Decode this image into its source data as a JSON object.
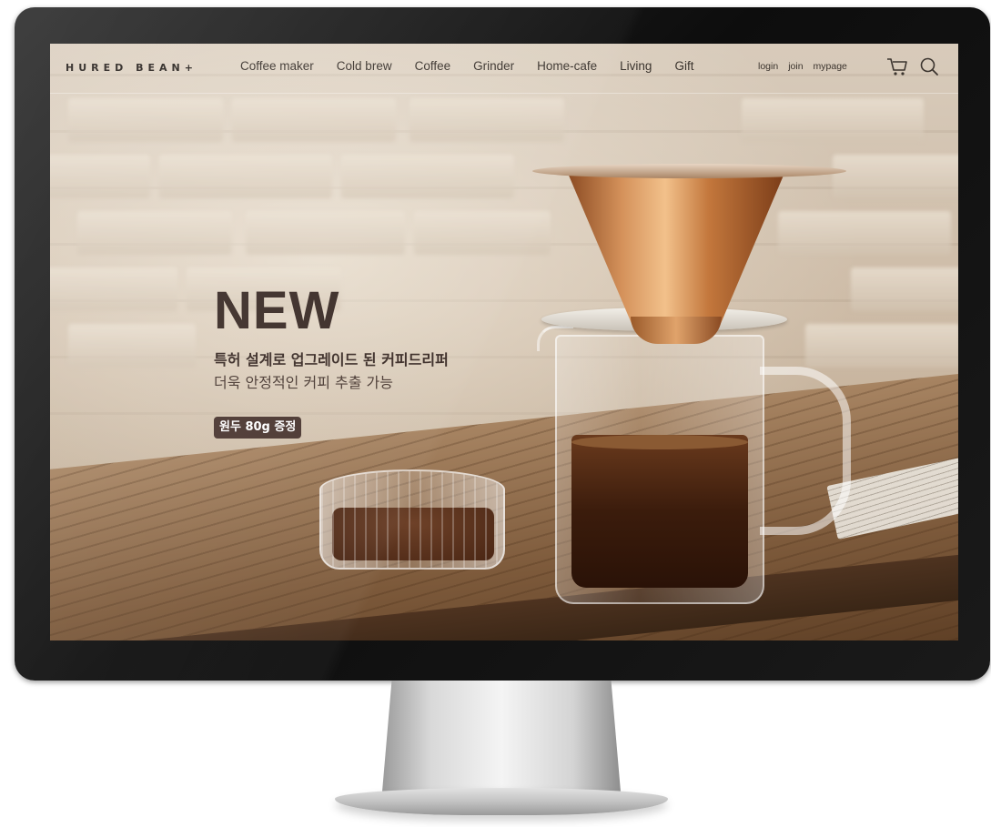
{
  "header": {
    "logo": "HURED BEAN+",
    "menu": [
      {
        "label": "Coffee maker"
      },
      {
        "label": "Cold brew"
      },
      {
        "label": "Coffee"
      },
      {
        "label": "Grinder"
      },
      {
        "label": "Home-cafe"
      },
      {
        "label": "Living"
      },
      {
        "label": "Gift"
      }
    ],
    "util": [
      {
        "label": "login"
      },
      {
        "label": "join"
      },
      {
        "label": "mypage"
      }
    ],
    "icons": [
      "cart-icon",
      "search-icon"
    ]
  },
  "hero": {
    "title": "NEW",
    "line1": "특허 설계로 업그레이드 된 커피드리퍼",
    "line2": "더욱 안정적인 커피 추출 가능",
    "badge": "원두 80g 증정"
  },
  "colors": {
    "text_dark": "#3a2b26",
    "badge_bg": "#4a3630",
    "monitor_frame": "#111111"
  }
}
